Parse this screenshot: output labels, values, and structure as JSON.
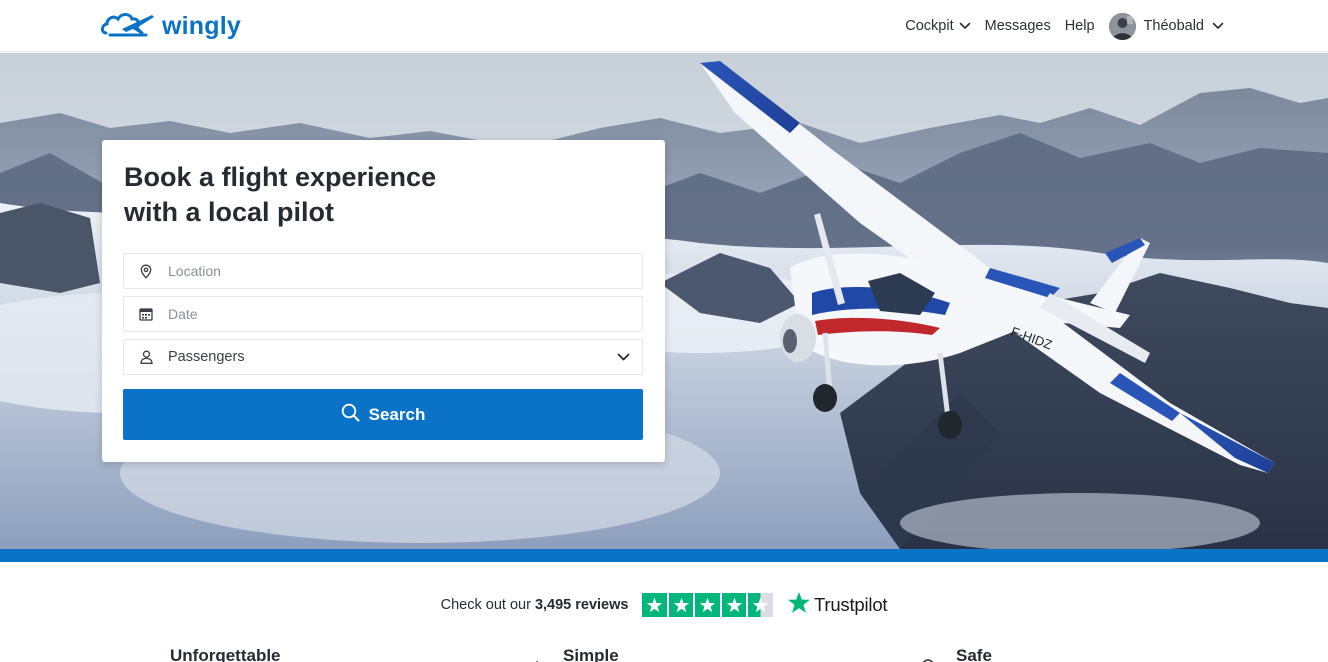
{
  "header": {
    "logo_text": "wingly",
    "nav": [
      {
        "label": "Cockpit",
        "dropdown": true
      },
      {
        "label": "Messages",
        "dropdown": false
      },
      {
        "label": "Help",
        "dropdown": false
      }
    ],
    "user": {
      "name": "Théobald",
      "dropdown": true
    }
  },
  "search_card": {
    "title_line1": "Book a flight experience",
    "title_line2": "with a local pilot",
    "location_placeholder": "Location",
    "date_placeholder": "Date",
    "passengers_label": "Passengers",
    "search_label": "Search"
  },
  "reviews": {
    "prefix": "Check out our",
    "count": "3,495 reviews",
    "rating_stars": 4.5,
    "brand": "Trustpilot"
  },
  "features": [
    {
      "title": "Unforgettable"
    },
    {
      "title": "Simple"
    },
    {
      "title": "Safe"
    }
  ],
  "colors": {
    "brand_blue": "#0a73c8",
    "trustpilot_green": "#00b67a",
    "text_dark": "#262b33"
  },
  "icons": [
    "wingly-logo-icon",
    "chevron-down-icon",
    "location-pin-icon",
    "calendar-icon",
    "user-icon",
    "search-icon",
    "star-icon",
    "trustpilot-star-icon"
  ]
}
